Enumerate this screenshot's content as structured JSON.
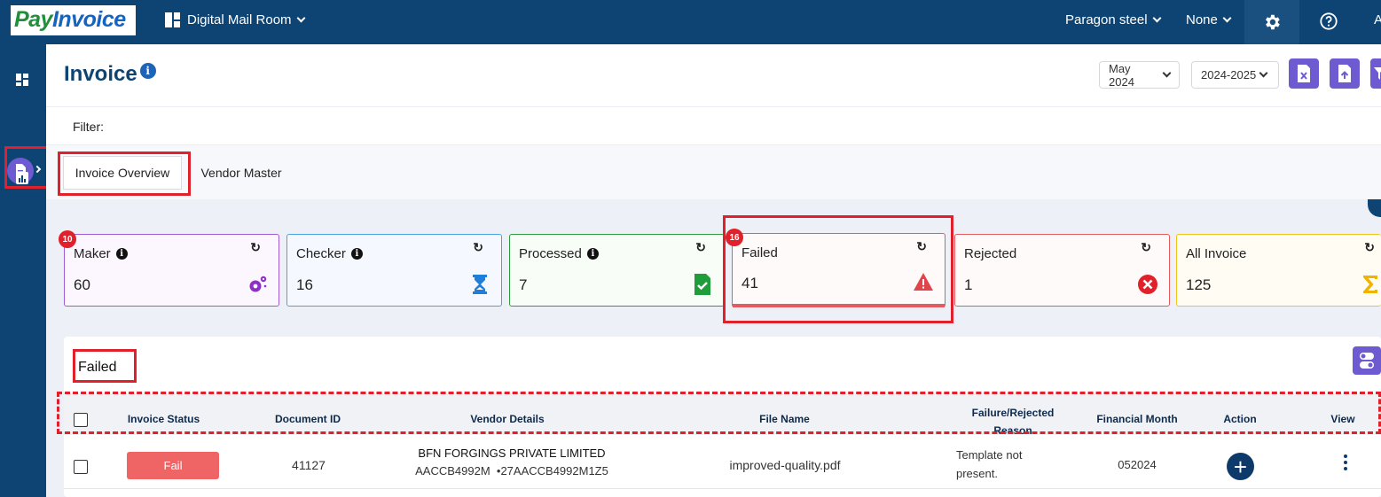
{
  "topbar": {
    "logo_part1": "Pay",
    "logo_part2": "Invoice",
    "app_name": "Digital Mail Room",
    "company": "Paragon steel",
    "scope": "None",
    "avatar_initial": "A"
  },
  "page": {
    "title": "Invoice",
    "month_select": "May 2024",
    "year_select": "2024-2025",
    "filter_label": "Filter:"
  },
  "tabs": [
    {
      "label": "Invoice Overview",
      "active": true
    },
    {
      "label": "Vendor Master",
      "active": false
    }
  ],
  "cards": [
    {
      "label": "Maker",
      "value": "60",
      "badge": "10",
      "icon": "gears-icon",
      "border": "#a05ad2"
    },
    {
      "label": "Checker",
      "value": "16",
      "icon": "hourglass-icon",
      "border": "#4aa3df"
    },
    {
      "label": "Processed",
      "value": "7",
      "icon": "file-check-icon",
      "border": "#2e9b3e"
    },
    {
      "label": "Failed",
      "value": "41",
      "badge": "16",
      "icon": "warning-triangle-icon",
      "border": "#e35b5f"
    },
    {
      "label": "Rejected",
      "value": "1",
      "icon": "x-circle-icon",
      "border": "#e35b5f"
    },
    {
      "label": "All Invoice",
      "value": "125",
      "icon": "sigma-icon",
      "border": "#f0c419"
    }
  ],
  "table": {
    "title": "Failed",
    "headers": {
      "status": "Invoice Status",
      "document_id": "Document ID",
      "vendor": "Vendor Details",
      "file": "File Name",
      "reason_line1": "Failure/Rejected",
      "reason_line2": "Reason",
      "month": "Financial Month",
      "action": "Action",
      "view": "View"
    },
    "rows": [
      {
        "status": "Fail",
        "document_id": "41127",
        "vendor_name": "BFN FORGINGS PRIVATE LIMITED",
        "vendor_ids": "AACCB4992M  •27AACCB4992M1Z5",
        "file": "improved-quality.pdf",
        "reason_line1": "Template not",
        "reason_line2": "present.",
        "month": "052024"
      }
    ]
  },
  "colors": {
    "topbar": "#0d4474",
    "accent": "#6f5bd1",
    "highlight": "#e0202a",
    "fail": "#ef6464"
  }
}
